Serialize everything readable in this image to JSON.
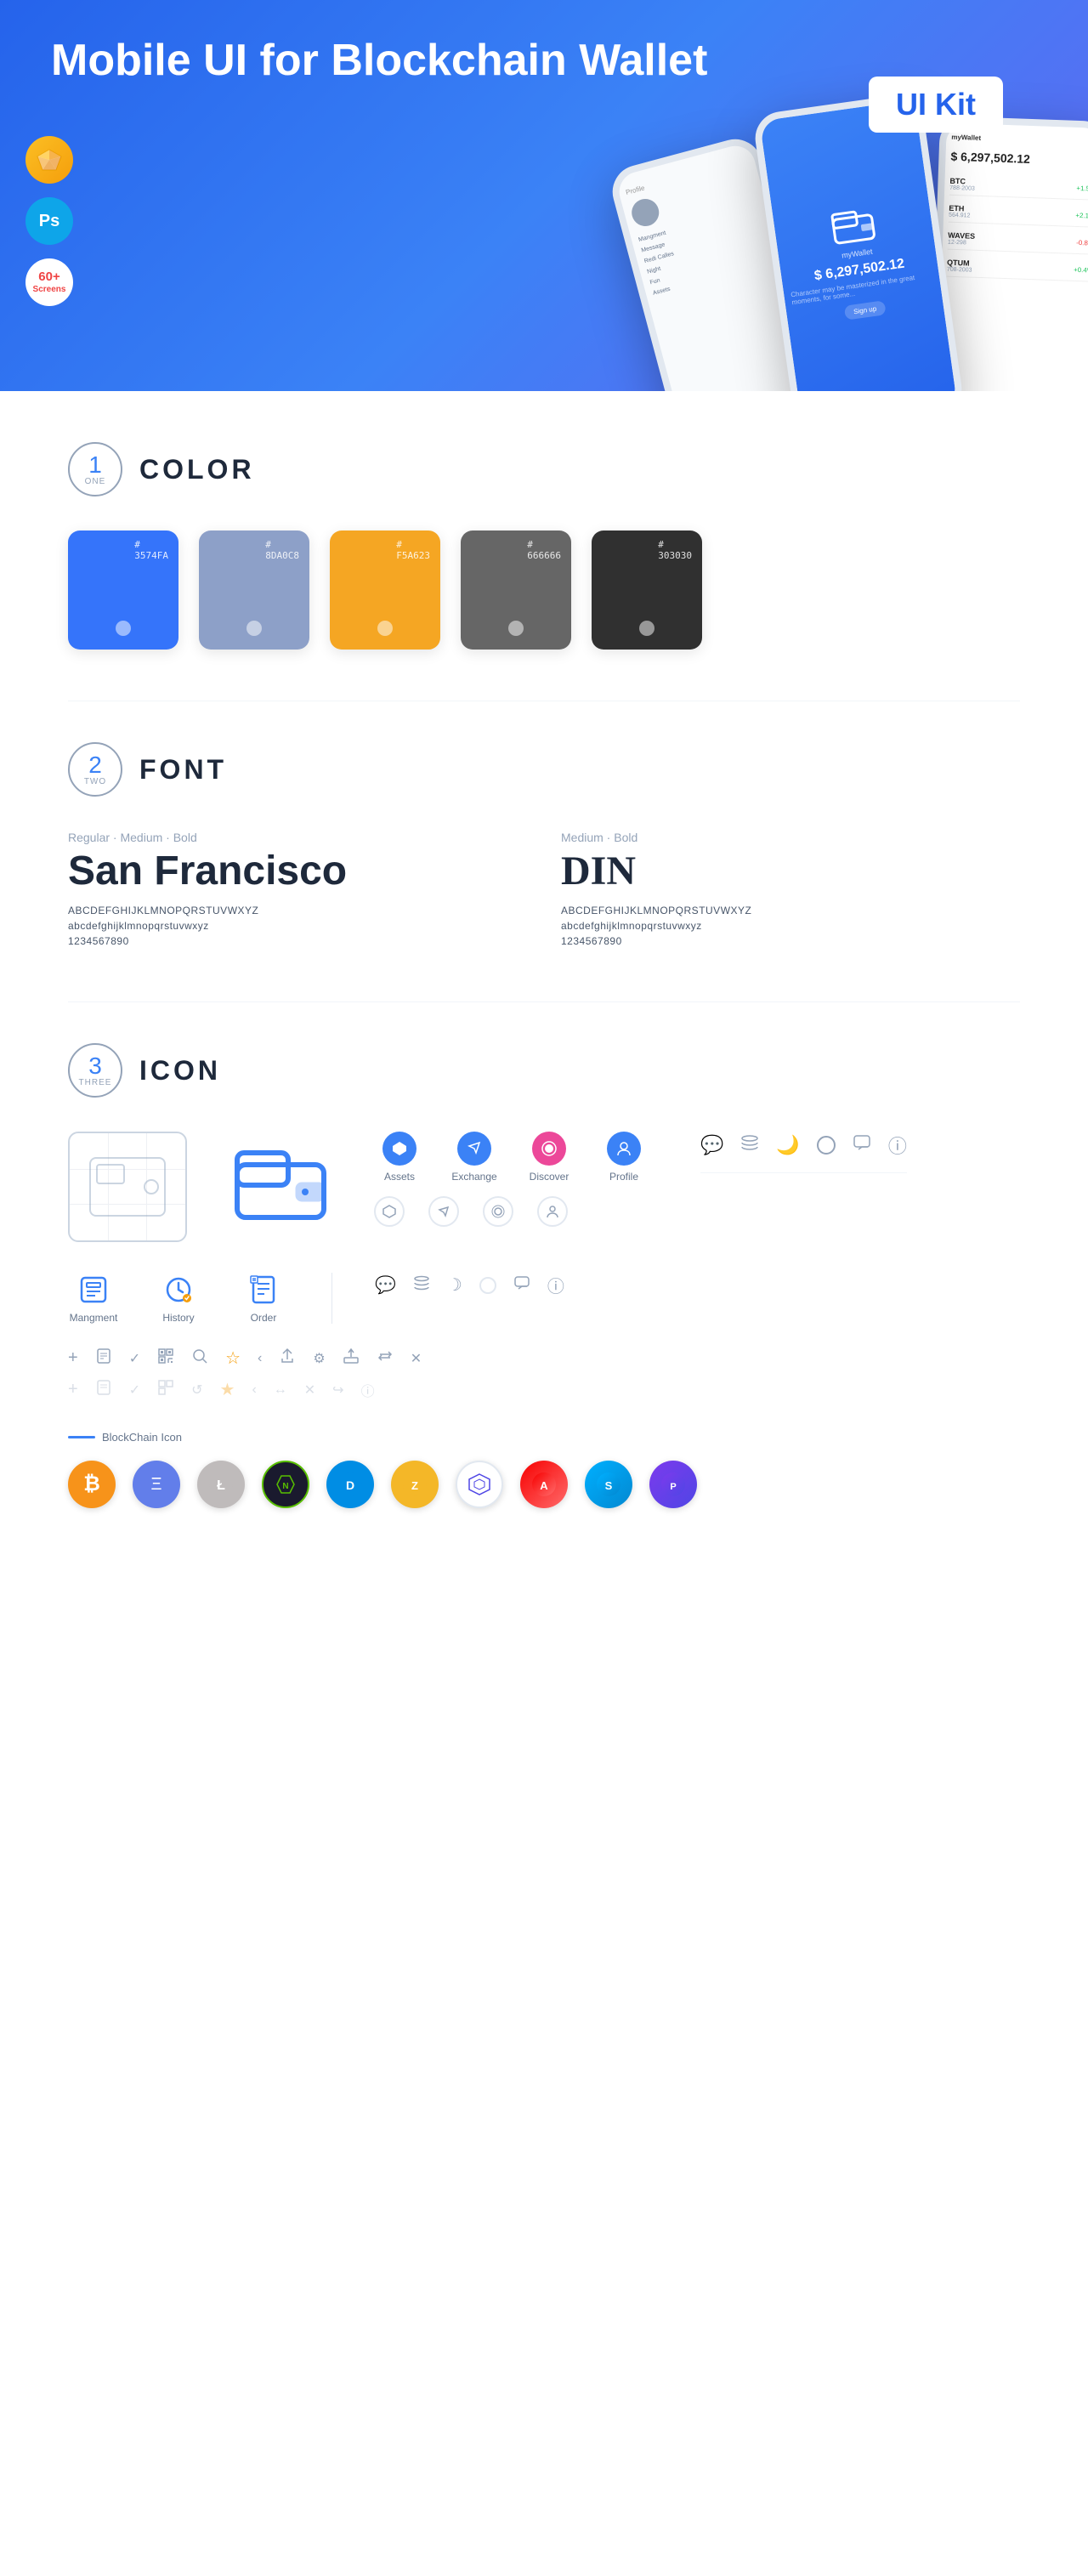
{
  "hero": {
    "title_regular": "Mobile UI for Blockchain ",
    "title_bold": "Wallet",
    "badge": "UI Kit",
    "icons": {
      "sketch_label": "Sketch",
      "ps_label": "Ps",
      "screens_count": "60+",
      "screens_label": "Screens"
    },
    "phone_center": {
      "wallet_label": "myWallet",
      "amount": "$ 6,297,502.12"
    }
  },
  "sections": {
    "color": {
      "number": "1",
      "word": "ONE",
      "title": "COLOR",
      "swatches": [
        {
          "hex": "#3574FA",
          "label": "#3574FA"
        },
        {
          "hex": "#8DA0C8",
          "label": "#8DA0C8"
        },
        {
          "hex": "#F5A623",
          "label": "#F5A623"
        },
        {
          "hex": "#666666",
          "label": "#666666"
        },
        {
          "hex": "#303030",
          "label": "#303030"
        }
      ]
    },
    "font": {
      "number": "2",
      "word": "TWO",
      "title": "FONT",
      "fonts": [
        {
          "style": "Regular · Medium · Bold",
          "name": "San Francisco",
          "uppercase": "ABCDEFGHIJKLMNOPQRSTUVWXYZ",
          "lowercase": "abcdefghijklmnopqrstuvwxyz",
          "numbers": "1234567890"
        },
        {
          "style": "Medium · Bold",
          "name": "DIN",
          "uppercase": "ABCDEFGHIJKLMNOPQRSTUVWXYZ",
          "lowercase": "abcdefghijklmnopqrstuvwxyz",
          "numbers": "1234567890"
        }
      ]
    },
    "icon": {
      "number": "3",
      "word": "THREE",
      "title": "ICON",
      "nav_icons": [
        {
          "label": "Assets"
        },
        {
          "label": "Exchange"
        },
        {
          "label": "Discover"
        },
        {
          "label": "Profile"
        }
      ],
      "tab_icons": [
        {
          "label": "Mangment"
        },
        {
          "label": "History"
        },
        {
          "label": "Order"
        }
      ],
      "blockchain_label": "BlockChain Icon",
      "crypto_coins": [
        {
          "label": "BTC",
          "symbol": "₿"
        },
        {
          "label": "ETH",
          "symbol": "Ξ"
        },
        {
          "label": "LTC",
          "symbol": "Ł"
        },
        {
          "label": "NEO",
          "symbol": "N"
        },
        {
          "label": "DASH",
          "symbol": "D"
        },
        {
          "label": "ZEC",
          "symbol": "Z"
        },
        {
          "label": "GRID",
          "symbol": "⬡"
        },
        {
          "label": "ARK",
          "symbol": "A"
        },
        {
          "label": "Storm",
          "symbol": "S"
        },
        {
          "label": "PLY",
          "symbol": "P"
        }
      ]
    }
  }
}
